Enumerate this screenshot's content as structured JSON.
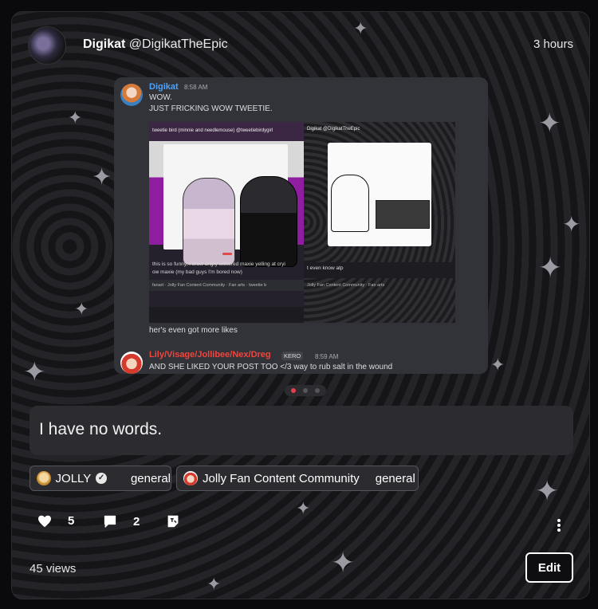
{
  "post": {
    "author_name": "Digikat",
    "author_handle": "@DigikatTheEpic",
    "time_ago": "3 hours",
    "body": "I have no words.",
    "views": "45 views"
  },
  "screenshot": {
    "msg1": {
      "user": "Digikat",
      "time": "8:58 AM",
      "line1": "WOW.",
      "line2": "JUST FRICKING WOW TWEETIE.",
      "user_color": "#4aa3ff"
    },
    "left_image": {
      "header": "tweetie bird (minnie and needlemouse) @tweetiebirdygirl",
      "caption_line1": "this is so funny, I draw angry withered maxie yelling at cryi",
      "caption_line2": "ow maxie (my bad guys I'm bored now)",
      "tag1": "fanart",
      "tag2": "Jolly Fan Content Community",
      "tag3": "Fan arts",
      "tag4": "tweetie b"
    },
    "right_image": {
      "header": "Digikat @DigikatTheEpic",
      "caption": "t even know atp",
      "tag1": "Jolly Fan Content Community",
      "tag2": "Fan arts"
    },
    "followup": "her's even got more likes",
    "msg2": {
      "user": "Lily/Visage/Jollibee/Nex/Dreg",
      "badge": "KERO",
      "time": "8:59 AM",
      "text": "AND SHE LIKED YOUR POST TOO </3 way to rub salt in the wound",
      "user_color": "#f2453d"
    }
  },
  "carousel": {
    "count": 3,
    "active_index": 0,
    "active_color": "#e8404a"
  },
  "chips": [
    {
      "community": "JOLLY",
      "channel": "general",
      "verified": true
    },
    {
      "community": "Jolly Fan Content Community",
      "channel": "general",
      "verified": false
    }
  ],
  "actions": {
    "likes": "5",
    "comments": "2",
    "icons": [
      "heart-icon",
      "comment-icon",
      "tag-icon",
      "more-icon"
    ]
  },
  "edit_label": "Edit"
}
